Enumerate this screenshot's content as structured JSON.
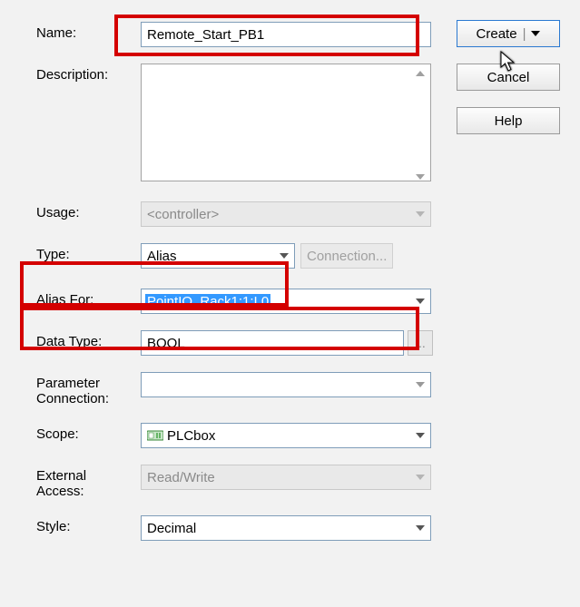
{
  "labels": {
    "name": "Name:",
    "description": "Description:",
    "usage": "Usage:",
    "type": "Type:",
    "alias_for": "Alias For:",
    "data_type": "Data Type:",
    "param_conn": "Parameter\nConnection:",
    "scope": "Scope:",
    "ext_access": "External\nAccess:",
    "style": "Style:"
  },
  "values": {
    "name": "Remote_Start_PB1",
    "description": "",
    "usage": "<controller>",
    "type": "Alias",
    "connection_btn": "Connection...",
    "alias_for": "PointIO_Rack1:1:I.0",
    "data_type": "BOOL",
    "param_conn": "",
    "scope": "PLCbox",
    "ext_access": "Read/Write",
    "style": "Decimal",
    "ellipsis_btn": "..."
  },
  "buttons": {
    "create": "Create",
    "cancel": "Cancel",
    "help": "Help"
  },
  "disabled": {
    "usage": true,
    "connection": true,
    "param_conn": false,
    "ext_access": true
  }
}
